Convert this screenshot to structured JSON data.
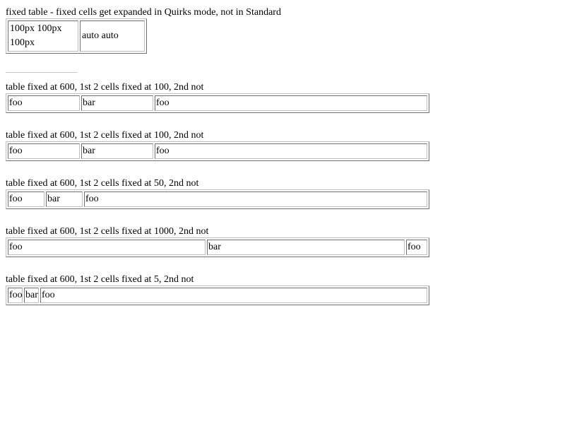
{
  "intro": {
    "caption": "fixed table - fixed cells get expanded in Quirks mode, not in Standard",
    "cells": [
      "100px 100px 100px",
      "auto auto"
    ]
  },
  "tables": [
    {
      "caption": "table fixed at 600, 1st 2 cells fixed at 100, 2nd not",
      "cells": [
        "foo",
        "bar",
        "foo"
      ]
    },
    {
      "caption": "table fixed at 600, 1st 2 cells fixed at 100, 2nd not",
      "cells": [
        "foo",
        "bar",
        "foo"
      ]
    },
    {
      "caption": "table fixed at 600, 1st 2 cells fixed at 50, 2nd not",
      "cells": [
        "foo",
        "bar",
        "foo"
      ]
    },
    {
      "caption": "table fixed at 600, 1st 2 cells fixed at 1000, 2nd not",
      "cells": [
        "foo",
        "bar",
        "foo"
      ]
    },
    {
      "caption": "table fixed at 600, 1st 2 cells fixed at 5, 2nd not",
      "cells": [
        "foo",
        "bar",
        "foo"
      ]
    }
  ]
}
